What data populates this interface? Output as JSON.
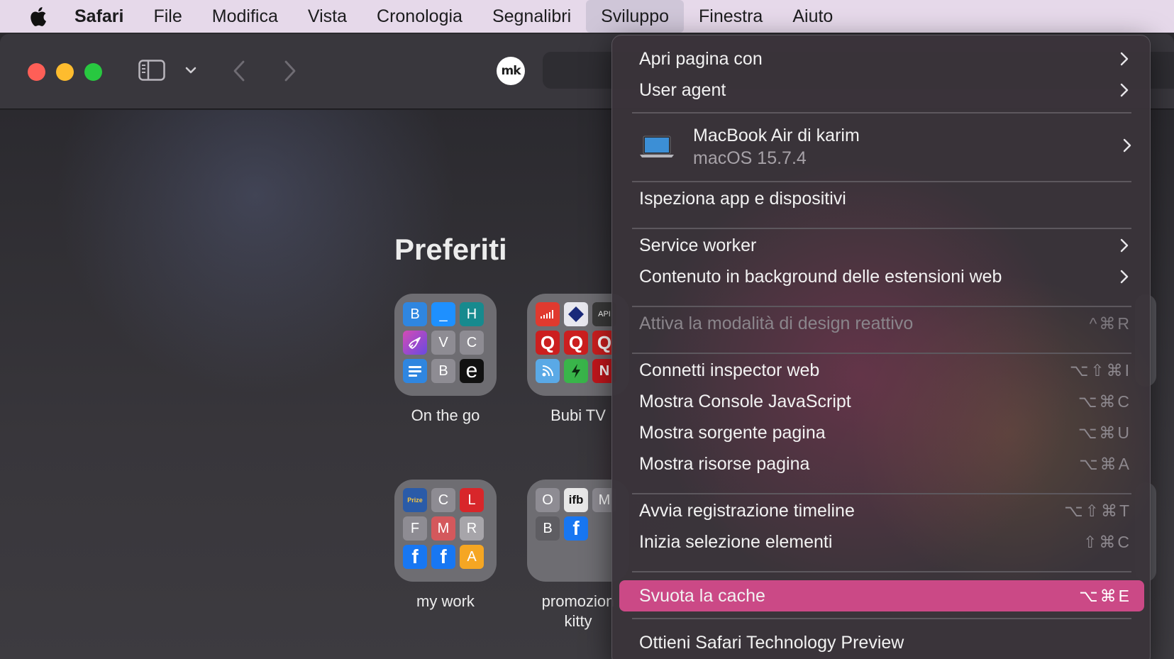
{
  "menubar": {
    "app": "Safari",
    "items": [
      "File",
      "Modifica",
      "Vista",
      "Cronologia",
      "Segnalibri",
      "Sviluppo",
      "Finestra",
      "Aiuto"
    ],
    "active": "Sviluppo"
  },
  "toolbar": {
    "extension_badge": "mk"
  },
  "start_page": {
    "title": "Preferiti",
    "folders": [
      {
        "label": "On the go",
        "tiles": [
          "B",
          "_",
          "H",
          "rocket",
          "V",
          "C",
          "list",
          "B",
          "e"
        ]
      },
      {
        "label": "Bubi TV",
        "tiles": [
          "signal",
          "diamond",
          "API",
          "Q",
          "Q",
          "Q",
          "broadcast",
          "bolt",
          "N"
        ]
      },
      {
        "label": "my work",
        "tiles": [
          "Prize",
          "C",
          "L",
          "F",
          "M",
          "R",
          "f",
          "f",
          "A"
        ]
      },
      {
        "label": "promozion\nkitty",
        "tiles": [
          "O",
          "ifb",
          "M",
          "B",
          "f"
        ]
      }
    ]
  },
  "dev_menu": {
    "items": [
      {
        "label": "Apri pagina con",
        "submenu": true
      },
      {
        "label": "User agent",
        "submenu": true
      },
      {
        "label": "Ispeziona app e dispositivi"
      },
      {
        "label": "Service worker",
        "submenu": true
      },
      {
        "label": "Contenuto in background delle estensioni web",
        "submenu": true
      },
      {
        "label": "Attiva la modalità di design reattivo",
        "shortcut": "^⌘R",
        "disabled": true
      },
      {
        "label": "Connetti inspector web",
        "shortcut": "⌥⇧⌘I"
      },
      {
        "label": "Mostra Console JavaScript",
        "shortcut": "⌥⌘C"
      },
      {
        "label": "Mostra sorgente pagina",
        "shortcut": "⌥⌘U"
      },
      {
        "label": "Mostra risorse pagina",
        "shortcut": "⌥⌘A"
      },
      {
        "label": "Avvia registrazione timeline",
        "shortcut": "⌥⇧⌘T"
      },
      {
        "label": "Inizia selezione elementi",
        "shortcut": "⇧⌘C"
      },
      {
        "label": "Svuota la cache",
        "shortcut": "⌥⌘E",
        "selected": true
      },
      {
        "label": "Ottieni Safari Technology Preview"
      }
    ],
    "device": {
      "name": "MacBook Air di karim",
      "os": "macOS 15.7.4",
      "submenu": true
    }
  },
  "colors": {
    "menubar_bg": "#e6d9ea",
    "selection": "#cb4986",
    "traffic_red": "#fe5f57",
    "traffic_yellow": "#febc2e",
    "traffic_green": "#28c840"
  }
}
